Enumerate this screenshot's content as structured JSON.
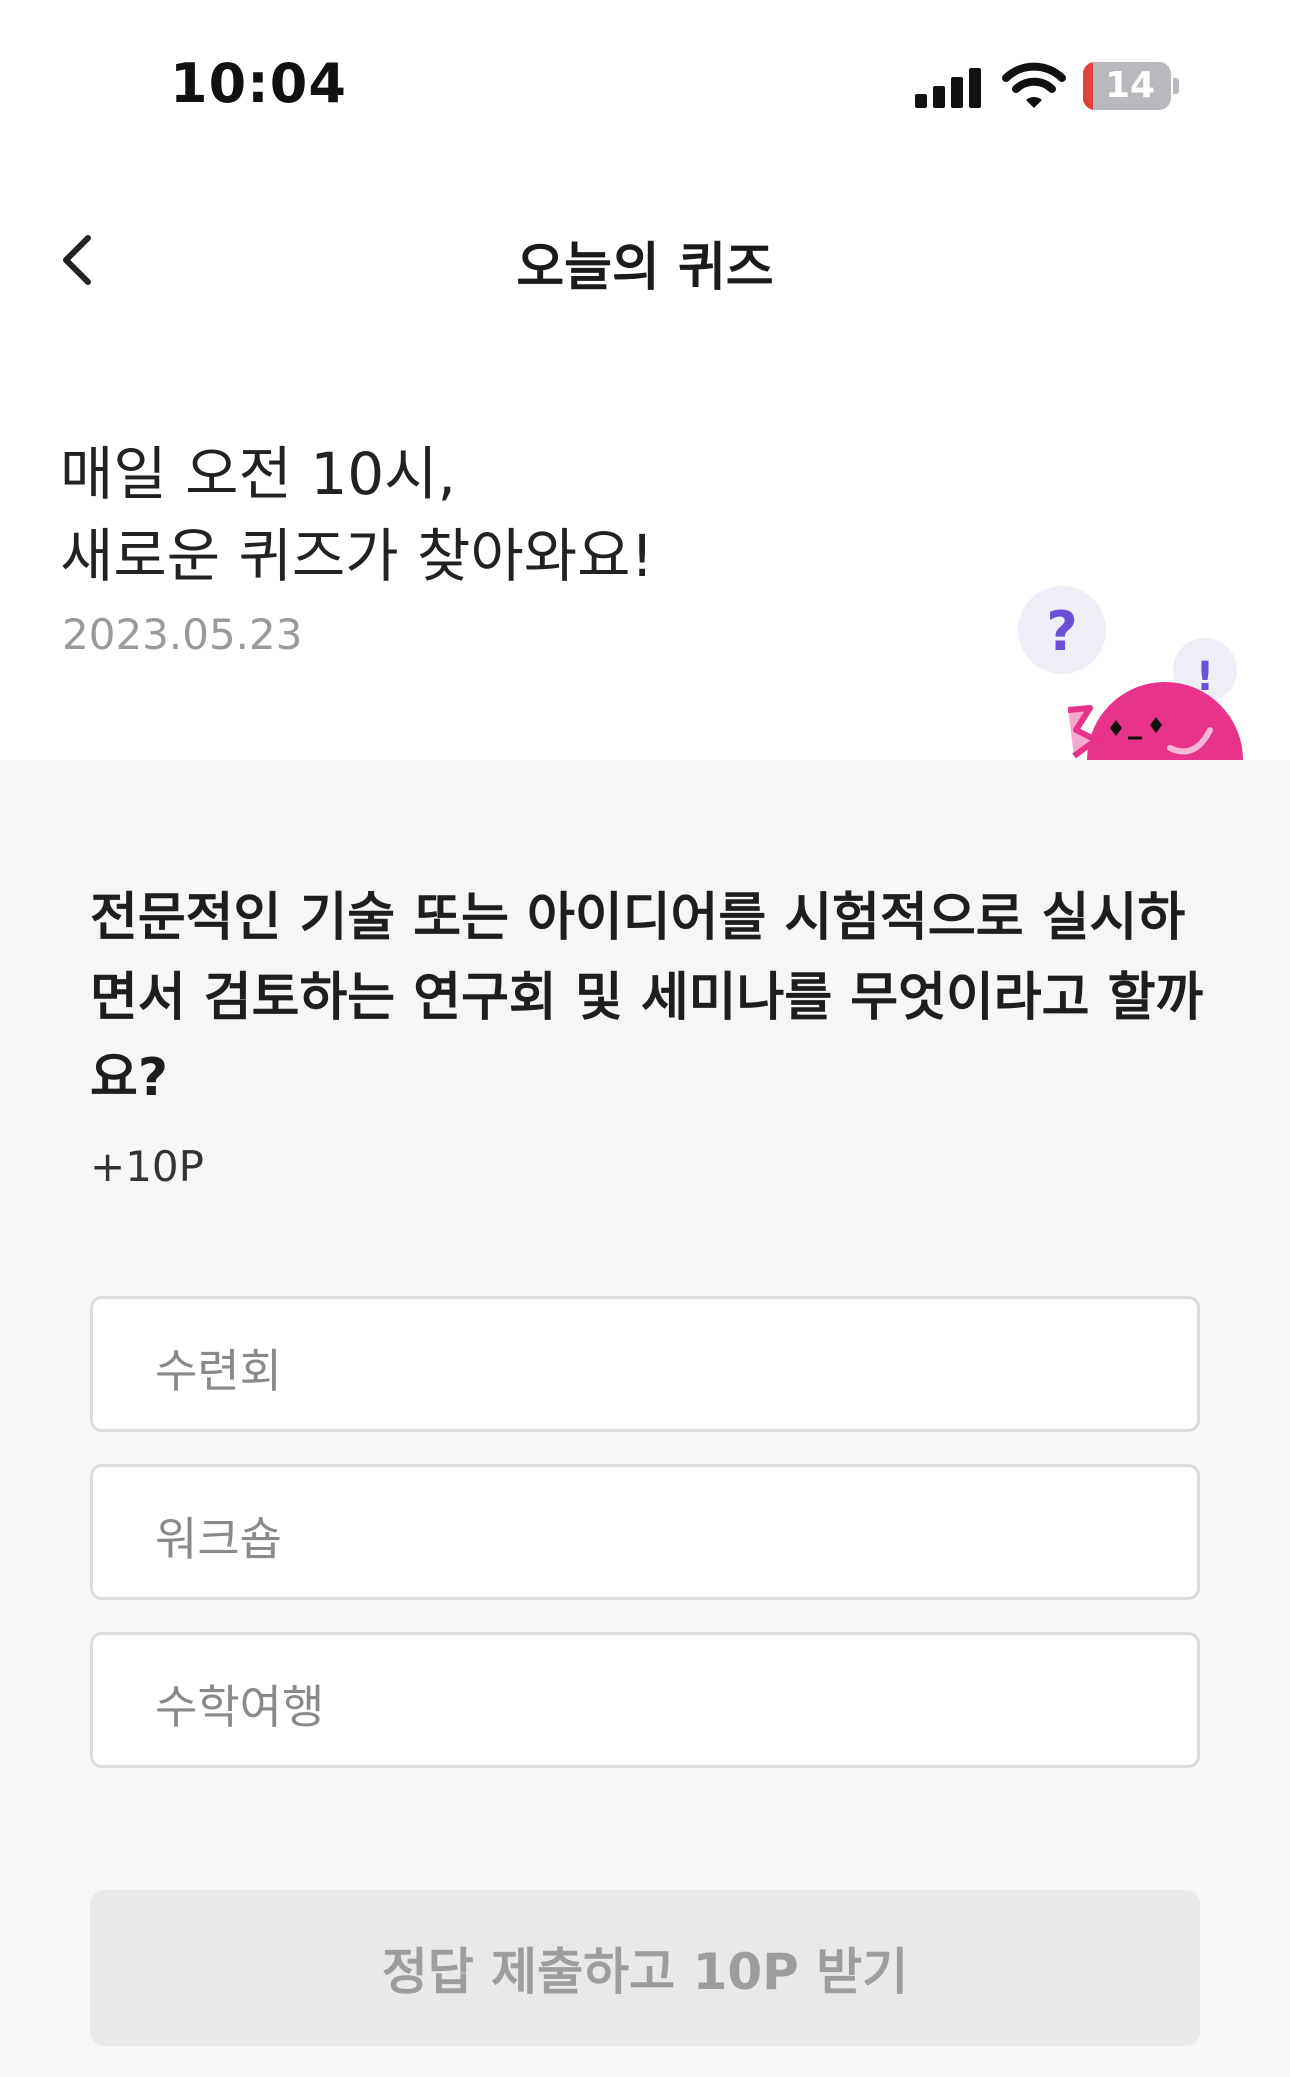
{
  "status_bar": {
    "time": "10:04",
    "battery": "14",
    "icons": [
      "signal-icon",
      "wifi-icon",
      "battery-icon"
    ]
  },
  "nav": {
    "title": "오늘의 퀴즈",
    "back_icon": "chevron-left-icon"
  },
  "hero": {
    "line1": "매일 오전 10시,",
    "line2": "새로운 퀴즈가 찾아와요!",
    "date": "2023.05.23",
    "illustration": "mascot-illustration"
  },
  "quiz": {
    "question": "전문적인 기술 또는 아이디어를 시험적으로 실시하면서 검토하는 연구회 및 세미나를 무엇이라고 할까요?",
    "points": "+10P",
    "options": [
      {
        "label": "수련회"
      },
      {
        "label": "워크숍"
      },
      {
        "label": "수학여행"
      }
    ],
    "submit_label": "정답 제출하고 10P 받기"
  },
  "colors": {
    "accent_pink": "#e8338a",
    "question_mark_purple": "#6b4fd8",
    "quiz_bg": "#f6f6f6",
    "button_bg": "#e9e9e9"
  }
}
